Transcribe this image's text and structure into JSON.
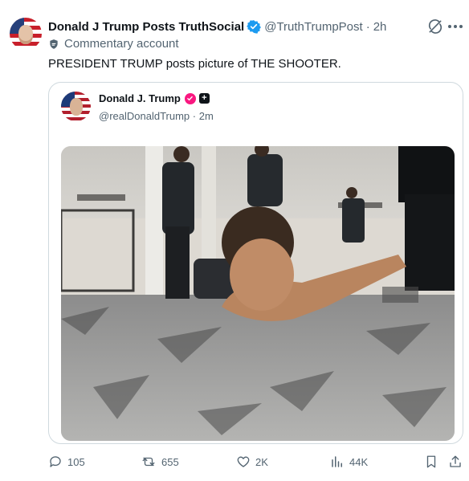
{
  "post": {
    "author_name": "Donald J Trump Posts TruthSocial",
    "author_handle": "@TruthTrumpPost",
    "separator": "·",
    "time": "2h",
    "account_label": "Commentary account",
    "text": "PRESIDENT TRUMP posts picture of THE SHOOTER."
  },
  "quote": {
    "author_name": "Donald J. Trump",
    "plus_badge": "+",
    "author_handle": "@realDonaldTrump",
    "separator": "·",
    "time": "2m"
  },
  "actions": {
    "replies": "105",
    "reposts": "655",
    "likes": "2K",
    "views": "44K"
  },
  "colors": {
    "text": "#0f1419",
    "secondary": "#536471",
    "verified_blue": "#1d9bf0",
    "border": "#cfd9de",
    "badge_pink": "#f91880"
  },
  "icons": [
    "verified-icon",
    "grok-icon",
    "more-icon",
    "shield-icon",
    "reply-icon",
    "repost-icon",
    "like-icon",
    "views-icon",
    "bookmark-icon",
    "share-icon"
  ]
}
